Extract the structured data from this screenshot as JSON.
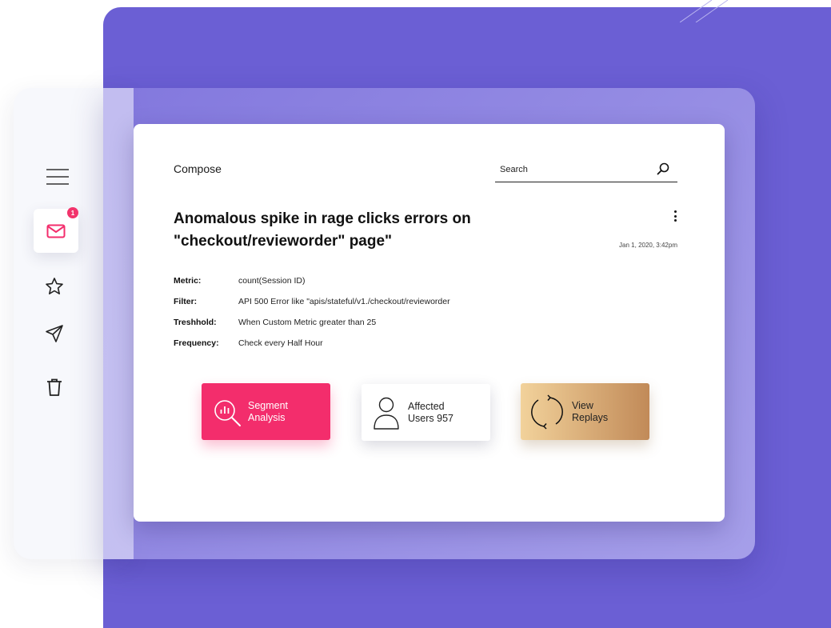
{
  "sidebar": {
    "items": [
      {
        "name": "menu",
        "icon": "hamburger-menu-icon"
      },
      {
        "name": "inbox",
        "icon": "mail-icon",
        "active": true,
        "badge": "1"
      },
      {
        "name": "starred",
        "icon": "star-icon"
      },
      {
        "name": "sent",
        "icon": "send-icon"
      },
      {
        "name": "trash",
        "icon": "trash-icon"
      }
    ]
  },
  "header": {
    "title": "Compose",
    "search_placeholder": "Search"
  },
  "alert": {
    "title": "Anomalous spike in rage clicks errors on \"checkout/revieworder\" page\"",
    "timestamp": "Jan 1, 2020, 3:42pm",
    "details": [
      {
        "label": "Metric:",
        "value": "count(Session ID)"
      },
      {
        "label": "Filter:",
        "value": "API 500 Error like \"apis/stateful/v1./checkout/revieworder"
      },
      {
        "label": "Treshhold:",
        "value": "When Custom Metric greater than 25"
      },
      {
        "label": "Frequency:",
        "value": "Check every Half Hour"
      }
    ]
  },
  "actions": {
    "segment": {
      "line1": "Segment",
      "line2": "Analysis"
    },
    "users": {
      "line1": "Affected",
      "line2": "Users 957"
    },
    "replays": {
      "line1": "View",
      "line2": "Replays"
    }
  },
  "colors": {
    "background_purple": "#6b5fd4",
    "accent_pink": "#f32d6c",
    "gold_start": "#f2d29b",
    "gold_end": "#c18a58",
    "badge": "#f2336b"
  }
}
